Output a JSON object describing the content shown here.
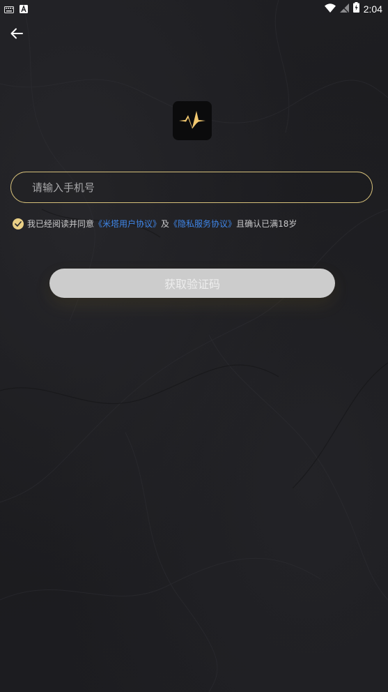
{
  "status_bar": {
    "time": "2:04",
    "icons": [
      "keyboard-icon",
      "a-notification-icon",
      "wifi-icon",
      "signal-off-icon",
      "battery-charging-icon"
    ]
  },
  "nav": {
    "back_icon": "back-arrow-icon"
  },
  "logo": {
    "icon": "pulse-logo-icon",
    "accent_color": "#f2c870"
  },
  "phone_field": {
    "placeholder": "请输入手机号",
    "value": "",
    "border_color": "#d6c07a"
  },
  "agreement": {
    "checked": true,
    "prefix": "我已经阅读并同意",
    "user_agreement": "《米塔用户协议》",
    "and": "及",
    "privacy_agreement": "《隐私服务协议》",
    "suffix": "且确认已满18岁",
    "link_color": "#3f86e8"
  },
  "actions": {
    "get_code_label": "获取验证码"
  }
}
